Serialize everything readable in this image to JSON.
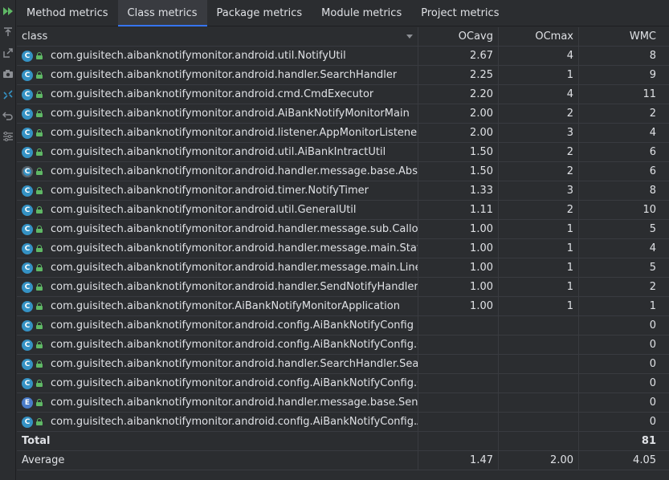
{
  "tabs": [
    {
      "label": "Method metrics"
    },
    {
      "label": "Class metrics"
    },
    {
      "label": "Package metrics"
    },
    {
      "label": "Module metrics"
    },
    {
      "label": "Project metrics"
    }
  ],
  "active_tab": "Class metrics",
  "columns": {
    "class": "class",
    "ocavg": "OCavg",
    "ocmax": "OCmax",
    "wmc": "WMC"
  },
  "rows": [
    {
      "icon": "C",
      "name": "com.guisitech.aibanknotifymonitor.android.util.NotifyUtil",
      "ocavg": "2.67",
      "ocmax": "4",
      "wmc": "8"
    },
    {
      "icon": "C",
      "name": "com.guisitech.aibanknotifymonitor.android.handler.SearchHandler",
      "ocavg": "2.25",
      "ocmax": "1",
      "wmc": "9"
    },
    {
      "icon": "C",
      "name": "com.guisitech.aibanknotifymonitor.android.cmd.CmdExecutor",
      "ocavg": "2.20",
      "ocmax": "4",
      "wmc": "11"
    },
    {
      "icon": "C",
      "name": "com.guisitech.aibanknotifymonitor.android.AiBankNotifyMonitorMain",
      "ocavg": "2.00",
      "ocmax": "2",
      "wmc": "2"
    },
    {
      "icon": "C",
      "name": "com.guisitech.aibanknotifymonitor.android.listener.AppMonitorListener",
      "ocavg": "2.00",
      "ocmax": "3",
      "wmc": "4"
    },
    {
      "icon": "C",
      "name": "com.guisitech.aibanknotifymonitor.android.util.AiBankIntractUtil",
      "ocavg": "1.50",
      "ocmax": "2",
      "wmc": "6"
    },
    {
      "icon": "C",
      "name": "com.guisitech.aibanknotifymonitor.android.handler.message.base.AbstractHandler",
      "ocavg": "1.50",
      "ocmax": "2",
      "wmc": "6"
    },
    {
      "icon": "C",
      "name": "com.guisitech.aibanknotifymonitor.android.timer.NotifyTimer",
      "ocavg": "1.33",
      "ocmax": "3",
      "wmc": "8"
    },
    {
      "icon": "C",
      "name": "com.guisitech.aibanknotifymonitor.android.util.GeneralUtil",
      "ocavg": "1.11",
      "ocmax": "2",
      "wmc": "10"
    },
    {
      "icon": "C",
      "name": "com.guisitech.aibanknotifymonitor.android.handler.message.sub.CalloutSender",
      "ocavg": "1.00",
      "ocmax": "1",
      "wmc": "5"
    },
    {
      "icon": "C",
      "name": "com.guisitech.aibanknotifymonitor.android.handler.message.main.StateSender",
      "ocavg": "1.00",
      "ocmax": "1",
      "wmc": "4"
    },
    {
      "icon": "C",
      "name": "com.guisitech.aibanknotifymonitor.android.handler.message.main.LineSender",
      "ocavg": "1.00",
      "ocmax": "1",
      "wmc": "5"
    },
    {
      "icon": "C",
      "name": "com.guisitech.aibanknotifymonitor.android.handler.SendNotifyHandler",
      "ocavg": "1.00",
      "ocmax": "1",
      "wmc": "2"
    },
    {
      "icon": "C",
      "name": "com.guisitech.aibanknotifymonitor.AiBankNotifyMonitorApplication",
      "ocavg": "1.00",
      "ocmax": "1",
      "wmc": "1"
    },
    {
      "icon": "C",
      "name": "com.guisitech.aibanknotifymonitor.android.config.AiBankNotifyConfig",
      "ocavg": "",
      "ocmax": "",
      "wmc": "0"
    },
    {
      "icon": "C",
      "name": "com.guisitech.aibanknotifymonitor.android.config.AiBankNotifyConfig.Config",
      "ocavg": "",
      "ocmax": "",
      "wmc": "0"
    },
    {
      "icon": "C",
      "name": "com.guisitech.aibanknotifymonitor.android.handler.SearchHandler.SearchNode",
      "ocavg": "",
      "ocmax": "",
      "wmc": "0"
    },
    {
      "icon": "C",
      "name": "com.guisitech.aibanknotifymonitor.android.config.AiBankNotifyConfig.CalloutConfig",
      "ocavg": "",
      "ocmax": "",
      "wmc": "0"
    },
    {
      "icon": "E",
      "name": "com.guisitech.aibanknotifymonitor.android.handler.message.base.SendStrategy",
      "ocavg": "",
      "ocmax": "",
      "wmc": "0"
    },
    {
      "icon": "C",
      "name": "com.guisitech.aibanknotifymonitor.android.config.AiBankNotifyConfig.AdbConfig",
      "ocavg": "",
      "ocmax": "",
      "wmc": "0"
    }
  ],
  "total": {
    "label": "Total",
    "ocavg": "",
    "ocmax": "",
    "wmc": "81"
  },
  "average": {
    "label": "Average",
    "ocavg": "1.47",
    "ocmax": "2.00",
    "wmc": "4.05"
  },
  "toolbar_icons": [
    "run-icon",
    "export-icon",
    "open-in-editor-icon",
    "snapshot-icon",
    "diff-icon",
    "undo-icon",
    "settings-icon"
  ]
}
